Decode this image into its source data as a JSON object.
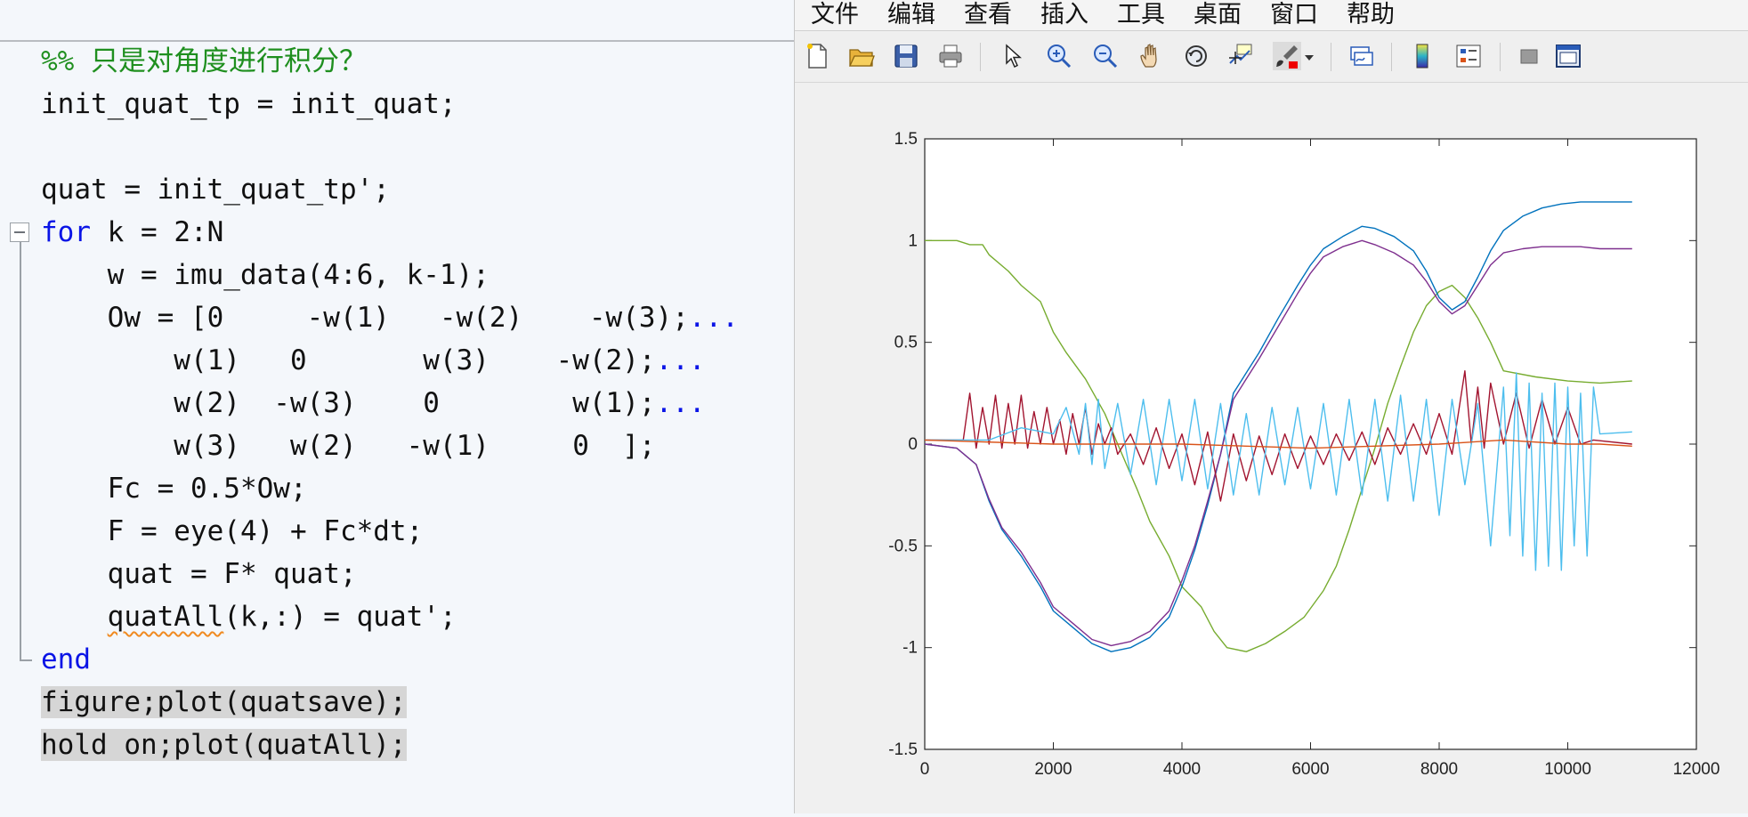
{
  "editor": {
    "lines": [
      {
        "parts": [
          {
            "t": "%% 只是对角度进行积分？",
            "c": "cmt"
          }
        ]
      },
      {
        "parts": [
          {
            "t": "init_quat_tp = init_quat;",
            "c": ""
          }
        ]
      },
      {
        "parts": [
          {
            "t": "",
            "c": ""
          }
        ]
      },
      {
        "parts": [
          {
            "t": "quat = init_quat_tp';",
            "c": ""
          }
        ]
      },
      {
        "parts": [
          {
            "t": "for",
            "c": "kw"
          },
          {
            "t": " k = 2:N",
            "c": ""
          }
        ]
      },
      {
        "parts": [
          {
            "t": "    w = imu_data(4:6, k-1);",
            "c": ""
          }
        ]
      },
      {
        "parts": [
          {
            "t": "    Ow = [0     -w(1)   -w(2)    -w(3);",
            "c": ""
          },
          {
            "t": "...",
            "c": "cont"
          }
        ]
      },
      {
        "parts": [
          {
            "t": "        w(1)   0       w(3)    -w(2);",
            "c": ""
          },
          {
            "t": "...",
            "c": "cont"
          }
        ]
      },
      {
        "parts": [
          {
            "t": "        w(2)  -w(3)    0        w(1);",
            "c": ""
          },
          {
            "t": "...",
            "c": "cont"
          }
        ]
      },
      {
        "parts": [
          {
            "t": "        w(3)   w(2)   -w(1)     0  ];",
            "c": ""
          }
        ]
      },
      {
        "parts": [
          {
            "t": "    Fc = 0.5*Ow;",
            "c": ""
          }
        ]
      },
      {
        "parts": [
          {
            "t": "    F = eye(4) + Fc*dt;",
            "c": ""
          }
        ]
      },
      {
        "parts": [
          {
            "t": "    quat = F* quat;",
            "c": ""
          }
        ]
      },
      {
        "parts": [
          {
            "t": "    ",
            "c": ""
          },
          {
            "t": "quatAll",
            "c": "squig"
          },
          {
            "t": "(k,:) = quat';",
            "c": ""
          }
        ]
      },
      {
        "parts": [
          {
            "t": "end",
            "c": "kw"
          }
        ]
      },
      {
        "parts": [
          {
            "t": "figure;plot(quatsave);",
            "c": "hl"
          }
        ]
      },
      {
        "parts": [
          {
            "t": "hold on;plot(quatAll);",
            "c": "hl"
          }
        ]
      }
    ]
  },
  "figure": {
    "menu": [
      "文件",
      "编辑",
      "查看",
      "插入",
      "工具",
      "桌面",
      "窗口",
      "帮助"
    ],
    "toolbar_icons": [
      "new-figure-icon",
      "open-folder-icon",
      "save-icon",
      "print-icon",
      "pointer-icon",
      "zoom-in-icon",
      "zoom-out-icon",
      "pan-hand-icon",
      "rotate-3d-icon",
      "data-cursor-icon",
      "brush-icon",
      "dropdown-arrow-icon",
      "link-plot-icon",
      "colorbar-icon",
      "legend-icon",
      "hide-plot-tools-icon",
      "show-plot-tools-icon"
    ]
  },
  "chart_data": {
    "type": "line",
    "xlim": [
      0,
      12000
    ],
    "ylim": [
      -1.5,
      1.5
    ],
    "xticks": [
      "0",
      "2000",
      "4000",
      "6000",
      "8000",
      "10000",
      "12000"
    ],
    "yticks": [
      "1.5",
      "1",
      "0.5",
      "0",
      "-0.5",
      "-1",
      "-1.5"
    ],
    "grid": false,
    "series": [
      {
        "color": "#77ac30",
        "x": [
          0,
          500,
          700,
          900,
          1000,
          1300,
          1500,
          1800,
          2000,
          2200,
          2500,
          2800,
          3000,
          3300,
          3500,
          3800,
          4000,
          4300,
          4500,
          4700,
          5000,
          5300,
          5600,
          5900,
          6200,
          6400,
          6600,
          6800,
          7000,
          7200,
          7400,
          7600,
          7800,
          8000,
          8200,
          8400,
          8600,
          8800,
          9000,
          9500,
          10000,
          10500,
          11000
        ],
        "y": [
          1.0,
          1.0,
          0.98,
          0.98,
          0.93,
          0.85,
          0.78,
          0.7,
          0.55,
          0.45,
          0.32,
          0.15,
          0.0,
          -0.22,
          -0.38,
          -0.55,
          -0.7,
          -0.8,
          -0.92,
          -1.0,
          -1.02,
          -0.98,
          -0.92,
          -0.85,
          -0.72,
          -0.6,
          -0.42,
          -0.22,
          -0.02,
          0.2,
          0.38,
          0.55,
          0.68,
          0.75,
          0.78,
          0.72,
          0.62,
          0.5,
          0.36,
          0.33,
          0.31,
          0.3,
          0.31
        ]
      },
      {
        "color": "#0072bd",
        "x": [
          0,
          500,
          800,
          1000,
          1200,
          1500,
          1800,
          2000,
          2300,
          2600,
          2900,
          3200,
          3500,
          3800,
          4000,
          4200,
          4400,
          4600,
          4800,
          5200,
          5500,
          5800,
          6000,
          6200,
          6500,
          6800,
          7000,
          7300,
          7600,
          7800,
          8000,
          8200,
          8400,
          8600,
          8800,
          9000,
          9300,
          9600,
          9900,
          10200,
          10500,
          11000
        ],
        "y": [
          0.0,
          -0.02,
          -0.1,
          -0.28,
          -0.42,
          -0.55,
          -0.7,
          -0.82,
          -0.9,
          -0.98,
          -1.02,
          -1.0,
          -0.95,
          -0.85,
          -0.7,
          -0.52,
          -0.3,
          -0.05,
          0.25,
          0.45,
          0.62,
          0.78,
          0.88,
          0.96,
          1.02,
          1.07,
          1.06,
          1.02,
          0.95,
          0.85,
          0.72,
          0.66,
          0.7,
          0.82,
          0.95,
          1.05,
          1.12,
          1.16,
          1.18,
          1.19,
          1.19,
          1.19
        ]
      },
      {
        "color": "#7e2f8e",
        "x": [
          0,
          500,
          800,
          1000,
          1200,
          1500,
          1800,
          2000,
          2300,
          2600,
          2900,
          3200,
          3500,
          3800,
          4000,
          4200,
          4400,
          4600,
          4800,
          5200,
          5500,
          5800,
          6000,
          6200,
          6500,
          6800,
          7000,
          7300,
          7600,
          7800,
          8000,
          8200,
          8400,
          8600,
          8800,
          9000,
          9300,
          9600,
          9900,
          10200,
          10500,
          11000
        ],
        "y": [
          0.0,
          -0.02,
          -0.1,
          -0.27,
          -0.41,
          -0.53,
          -0.68,
          -0.8,
          -0.88,
          -0.96,
          -0.99,
          -0.97,
          -0.92,
          -0.82,
          -0.67,
          -0.5,
          -0.28,
          -0.05,
          0.22,
          0.42,
          0.58,
          0.74,
          0.84,
          0.92,
          0.97,
          1.0,
          0.98,
          0.94,
          0.88,
          0.8,
          0.7,
          0.64,
          0.68,
          0.78,
          0.88,
          0.94,
          0.96,
          0.97,
          0.97,
          0.97,
          0.96,
          0.96
        ]
      },
      {
        "color": "#a2142f",
        "x": [
          0,
          600,
          700,
          800,
          900,
          1000,
          1100,
          1200,
          1300,
          1400,
          1500,
          1600,
          1700,
          1800,
          1900,
          2000,
          2100,
          2200,
          2300,
          2400,
          2500,
          2600,
          2700,
          2800,
          2900,
          3000,
          3200,
          3400,
          3600,
          3800,
          4000,
          4200,
          4400,
          4600,
          4800,
          5000,
          5200,
          5400,
          5600,
          5800,
          6000,
          6200,
          6400,
          6600,
          6800,
          7000,
          7200,
          7400,
          7600,
          7800,
          8000,
          8200,
          8400,
          8500,
          8600,
          8700,
          8800,
          9000,
          9200,
          9400,
          9600,
          9800,
          10000,
          10200,
          10400,
          11000
        ],
        "y": [
          0.02,
          0.02,
          0.25,
          -0.02,
          0.18,
          0.0,
          0.24,
          -0.02,
          0.2,
          0.0,
          0.24,
          -0.02,
          0.16,
          0.0,
          0.18,
          0.0,
          0.12,
          -0.05,
          0.15,
          0.0,
          0.18,
          -0.05,
          0.1,
          0.0,
          0.08,
          -0.05,
          0.05,
          -0.1,
          0.08,
          -0.12,
          0.05,
          -0.2,
          0.06,
          -0.28,
          0.05,
          -0.18,
          0.04,
          -0.15,
          0.05,
          -0.12,
          0.04,
          -0.1,
          0.05,
          -0.08,
          0.06,
          -0.1,
          0.08,
          -0.05,
          0.1,
          -0.05,
          0.15,
          -0.05,
          0.36,
          0.0,
          0.28,
          -0.02,
          0.3,
          0.0,
          0.25,
          -0.02,
          0.22,
          0.0,
          0.18,
          0.0,
          0.02,
          0.0
        ]
      },
      {
        "color": "#4dbeee",
        "x": [
          0,
          1000,
          1500,
          2000,
          2200,
          2400,
          2500,
          2600,
          2700,
          2800,
          3000,
          3200,
          3400,
          3600,
          3800,
          4000,
          4200,
          4400,
          4600,
          4800,
          5000,
          5200,
          5400,
          5600,
          5800,
          6000,
          6200,
          6400,
          6600,
          6800,
          7000,
          7200,
          7400,
          7600,
          7800,
          8000,
          8200,
          8400,
          8600,
          8800,
          9000,
          9100,
          9200,
          9300,
          9400,
          9500,
          9600,
          9700,
          9800,
          9900,
          10000,
          10100,
          10200,
          10300,
          10400,
          10500,
          11000
        ],
        "y": [
          0.02,
          0.02,
          0.08,
          0.05,
          0.18,
          -0.05,
          0.2,
          -0.1,
          0.22,
          -0.12,
          0.2,
          -0.15,
          0.22,
          -0.2,
          0.22,
          -0.18,
          0.22,
          -0.22,
          0.2,
          -0.25,
          0.15,
          -0.25,
          0.18,
          -0.2,
          0.18,
          -0.22,
          0.2,
          -0.25,
          0.22,
          -0.25,
          0.22,
          -0.28,
          0.24,
          -0.28,
          0.22,
          -0.35,
          0.22,
          -0.2,
          0.2,
          -0.5,
          0.28,
          -0.45,
          0.35,
          -0.55,
          0.3,
          -0.62,
          0.25,
          -0.6,
          0.3,
          -0.62,
          0.28,
          -0.5,
          0.25,
          -0.55,
          0.28,
          0.05,
          0.06
        ]
      },
      {
        "color": "#d95319",
        "x": [
          0,
          2000,
          4000,
          6000,
          8000,
          9000,
          10000,
          10500,
          11000
        ],
        "y": [
          0.02,
          0.0,
          0.0,
          -0.02,
          0.0,
          0.02,
          0.0,
          0.0,
          -0.01
        ]
      }
    ]
  }
}
